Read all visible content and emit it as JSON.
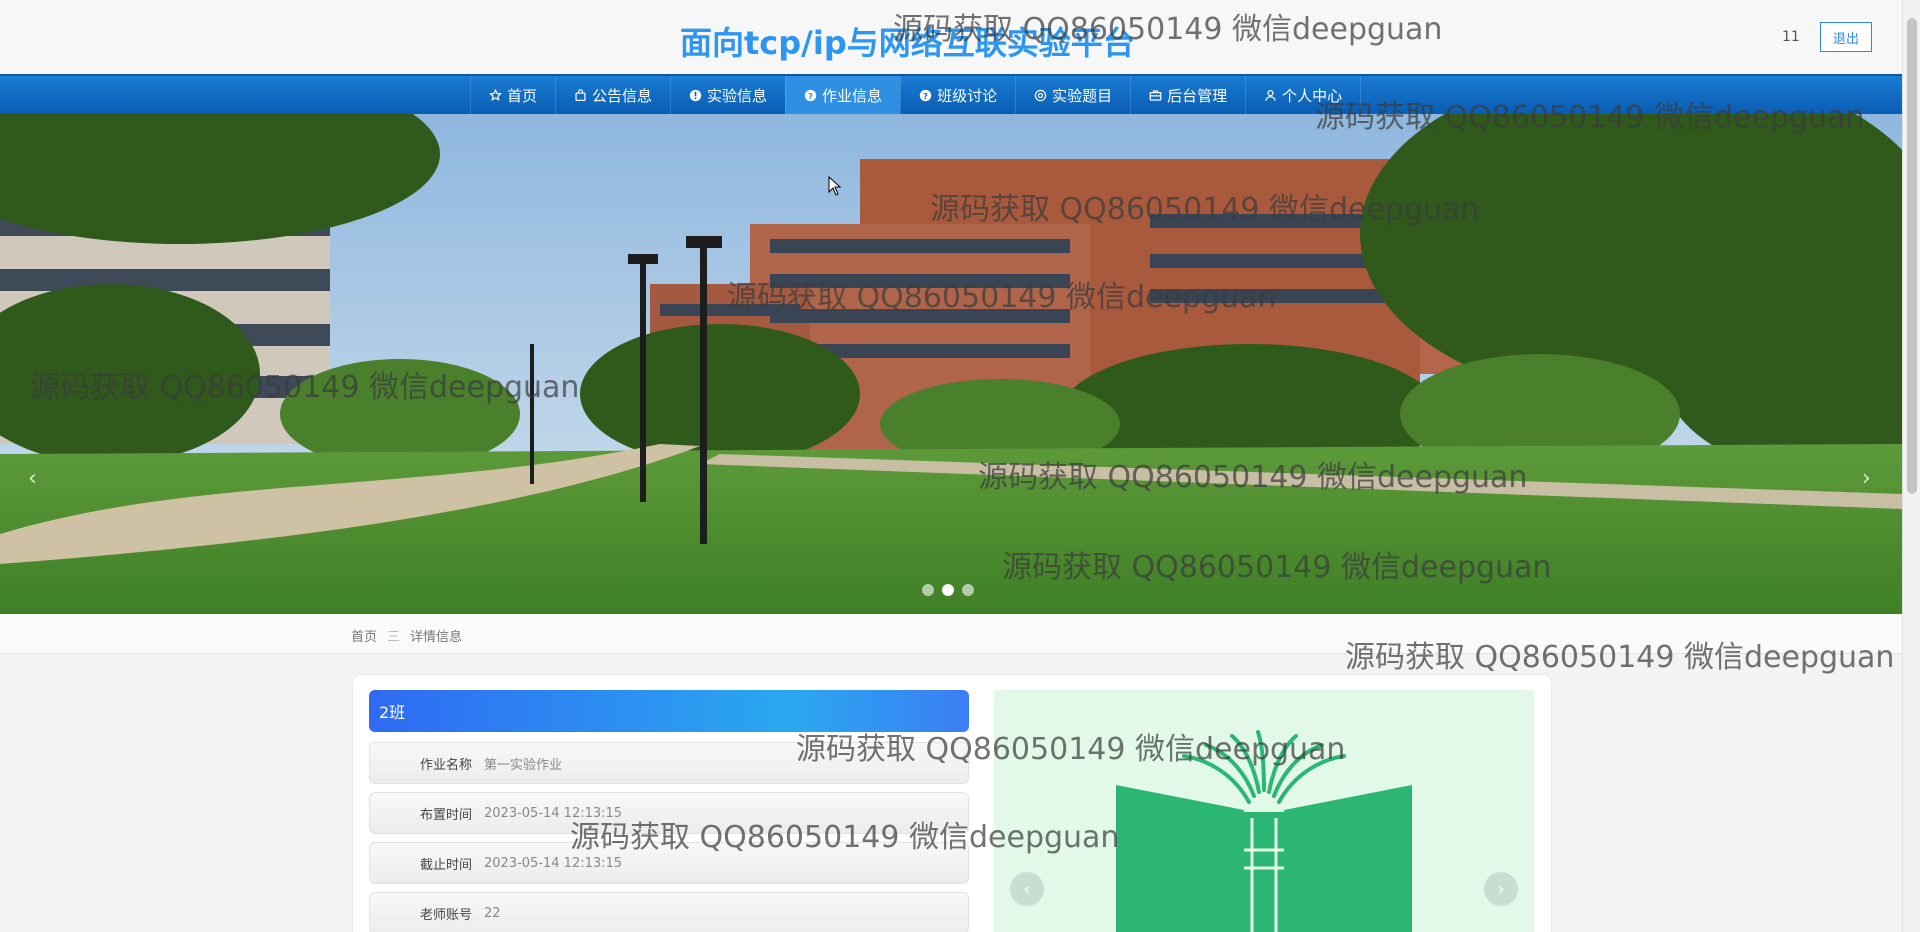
{
  "header": {
    "site_title": "面向tcp/ip与网络互联实验平台",
    "user_name": "11",
    "logout_label": "退出"
  },
  "nav": {
    "items": [
      {
        "label": "首页",
        "icon": "star-icon"
      },
      {
        "label": "公告信息",
        "icon": "bag-icon"
      },
      {
        "label": "实验信息",
        "icon": "info-icon"
      },
      {
        "label": "作业信息",
        "icon": "question-icon"
      },
      {
        "label": "班级讨论",
        "icon": "question-icon"
      },
      {
        "label": "实验题目",
        "icon": "settings-icon"
      },
      {
        "label": "后台管理",
        "icon": "briefcase-icon"
      },
      {
        "label": "个人中心",
        "icon": "user-icon"
      }
    ],
    "active_index": 3
  },
  "carousel": {
    "prev_label": "‹",
    "next_label": "›",
    "slide_count": 3,
    "active_slide": 2
  },
  "breadcrumb": {
    "home": "首页",
    "separator": "三",
    "current": "详情信息"
  },
  "detail": {
    "class_name": "2班",
    "fields": [
      {
        "label": "作业名称",
        "value": "第一实验作业"
      },
      {
        "label": "布置时间",
        "value": "2023-05-14 12:13:15"
      },
      {
        "label": "截止时间",
        "value": "2023-05-14 12:13:15"
      },
      {
        "label": "老师账号",
        "value": "22"
      }
    ]
  },
  "image_panel": {
    "prev_label": "‹",
    "next_label": "›"
  },
  "watermark": "源码获取 QQ86050149 微信deepguan",
  "colors": {
    "title_blue": "#2d96f0",
    "nav_blue": "#0a5db3",
    "nav_active": "#2f8fe2",
    "panel_green": "#e2f9ea",
    "book_green": "#2bb673"
  }
}
